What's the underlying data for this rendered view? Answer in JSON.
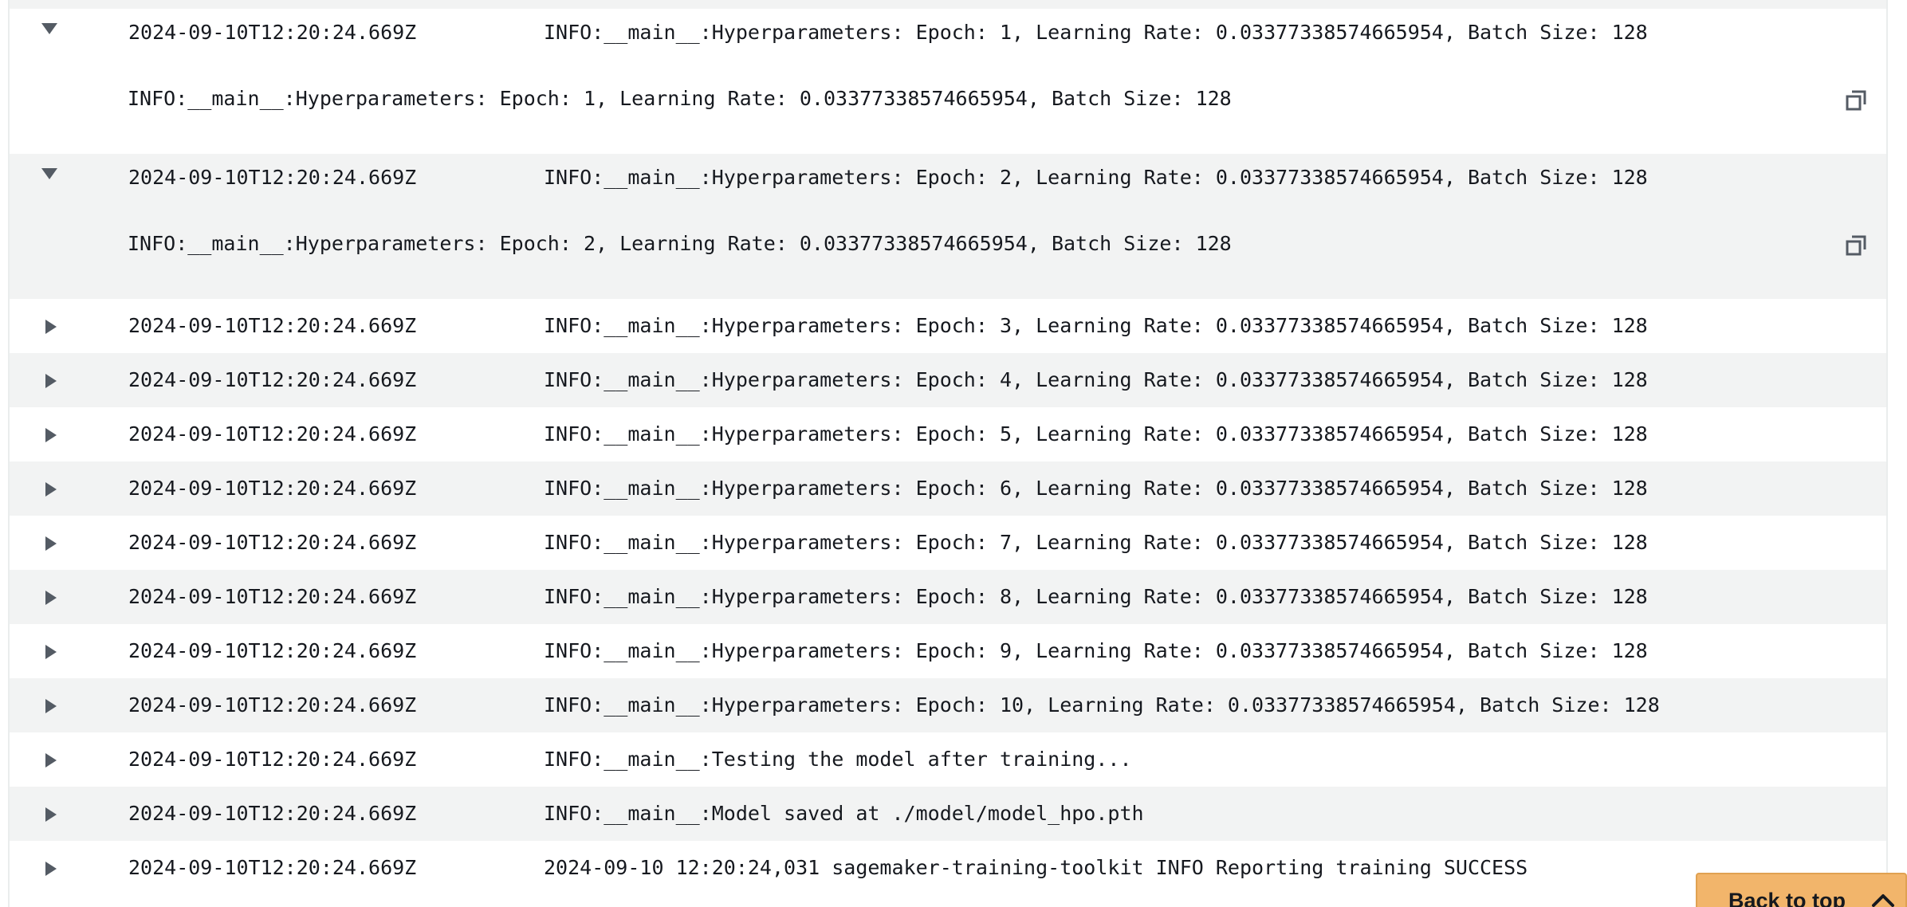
{
  "log_events": [
    {
      "expanded": true,
      "timestamp": "2024-09-10T12:20:24.669Z",
      "message": "INFO:__main__:Hyperparameters: Epoch: 1, Learning Rate: 0.03377338574665954, Batch Size: 128",
      "detail": "INFO:__main__:Hyperparameters: Epoch: 1, Learning Rate: 0.03377338574665954, Batch Size: 128"
    },
    {
      "expanded": true,
      "timestamp": "2024-09-10T12:20:24.669Z",
      "message": "INFO:__main__:Hyperparameters: Epoch: 2, Learning Rate: 0.03377338574665954, Batch Size: 128",
      "detail": "INFO:__main__:Hyperparameters: Epoch: 2, Learning Rate: 0.03377338574665954, Batch Size: 128"
    },
    {
      "expanded": false,
      "timestamp": "2024-09-10T12:20:24.669Z",
      "message": "INFO:__main__:Hyperparameters: Epoch: 3, Learning Rate: 0.03377338574665954, Batch Size: 128"
    },
    {
      "expanded": false,
      "timestamp": "2024-09-10T12:20:24.669Z",
      "message": "INFO:__main__:Hyperparameters: Epoch: 4, Learning Rate: 0.03377338574665954, Batch Size: 128"
    },
    {
      "expanded": false,
      "timestamp": "2024-09-10T12:20:24.669Z",
      "message": "INFO:__main__:Hyperparameters: Epoch: 5, Learning Rate: 0.03377338574665954, Batch Size: 128"
    },
    {
      "expanded": false,
      "timestamp": "2024-09-10T12:20:24.669Z",
      "message": "INFO:__main__:Hyperparameters: Epoch: 6, Learning Rate: 0.03377338574665954, Batch Size: 128"
    },
    {
      "expanded": false,
      "timestamp": "2024-09-10T12:20:24.669Z",
      "message": "INFO:__main__:Hyperparameters: Epoch: 7, Learning Rate: 0.03377338574665954, Batch Size: 128"
    },
    {
      "expanded": false,
      "timestamp": "2024-09-10T12:20:24.669Z",
      "message": "INFO:__main__:Hyperparameters: Epoch: 8, Learning Rate: 0.03377338574665954, Batch Size: 128"
    },
    {
      "expanded": false,
      "timestamp": "2024-09-10T12:20:24.669Z",
      "message": "INFO:__main__:Hyperparameters: Epoch: 9, Learning Rate: 0.03377338574665954, Batch Size: 128"
    },
    {
      "expanded": false,
      "timestamp": "2024-09-10T12:20:24.669Z",
      "message": "INFO:__main__:Hyperparameters: Epoch: 10, Learning Rate: 0.03377338574665954, Batch Size: 128"
    },
    {
      "expanded": false,
      "timestamp": "2024-09-10T12:20:24.669Z",
      "message": "INFO:__main__:Testing the model after training..."
    },
    {
      "expanded": false,
      "timestamp": "2024-09-10T12:20:24.669Z",
      "message": "INFO:__main__:Model saved at ./model/model_hpo.pth"
    },
    {
      "expanded": false,
      "timestamp": "2024-09-10T12:20:24.669Z",
      "message": "2024-09-10 12:20:24,031 sagemaker-training-toolkit INFO Reporting training SUCCESS"
    }
  ],
  "icons": {
    "expanded_toggle": "caret-down-icon",
    "collapsed_toggle": "caret-right-icon",
    "copy": "copy-icon",
    "back_to_top": "chevron-up-icon"
  },
  "back_to_top": {
    "label": "Back to top"
  },
  "colors": {
    "row_alt_background": "#f2f3f3",
    "back_to_top_background": "#f2b56b",
    "icon_color": "#545b64"
  }
}
